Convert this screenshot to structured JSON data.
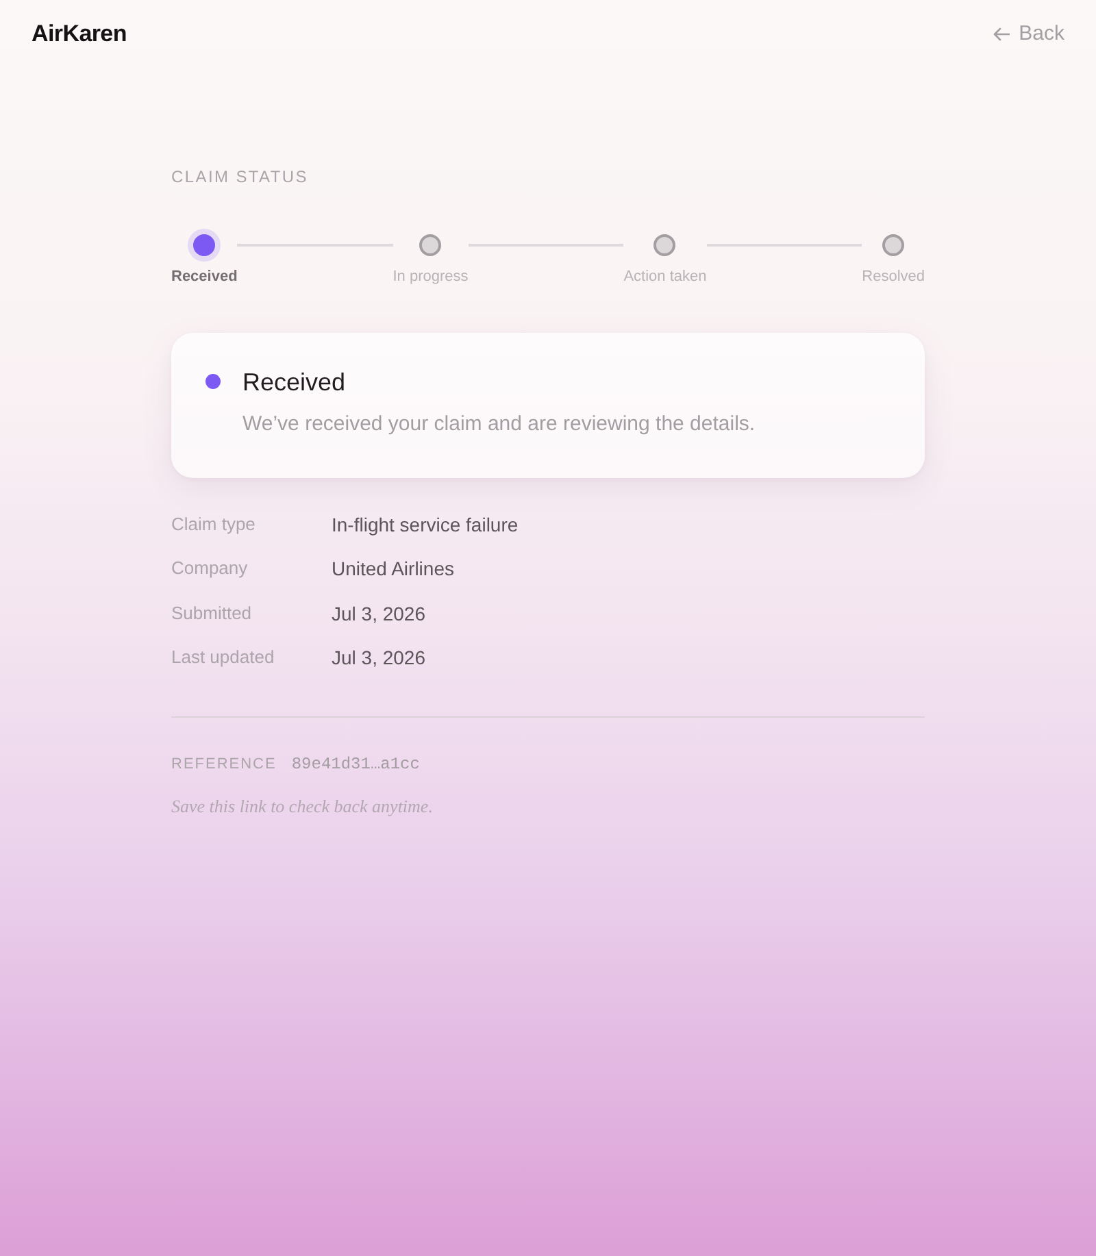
{
  "header": {
    "brand": "AirKaren",
    "back_label": "Back"
  },
  "claim_status": {
    "heading": "CLAIM STATUS",
    "steps": [
      {
        "label": "Received",
        "selected": true
      },
      {
        "label": "In progress",
        "selected": false
      },
      {
        "label": "Action taken",
        "selected": false
      },
      {
        "label": "Resolved",
        "selected": false
      }
    ]
  },
  "status_card": {
    "title": "Received",
    "description": "We’ve received your claim and are reviewing the details."
  },
  "details": [
    {
      "label": "Claim type",
      "value": "In-flight service failure"
    },
    {
      "label": "Company",
      "value": "United Airlines"
    },
    {
      "label": "Submitted",
      "value": "Jul 3, 2026"
    },
    {
      "label": "Last updated",
      "value": "Jul 3, 2026"
    }
  ],
  "reference": {
    "label": "REFERENCE",
    "value": "89e41d31…a1cc"
  },
  "note": "Save this link to check back anytime."
}
